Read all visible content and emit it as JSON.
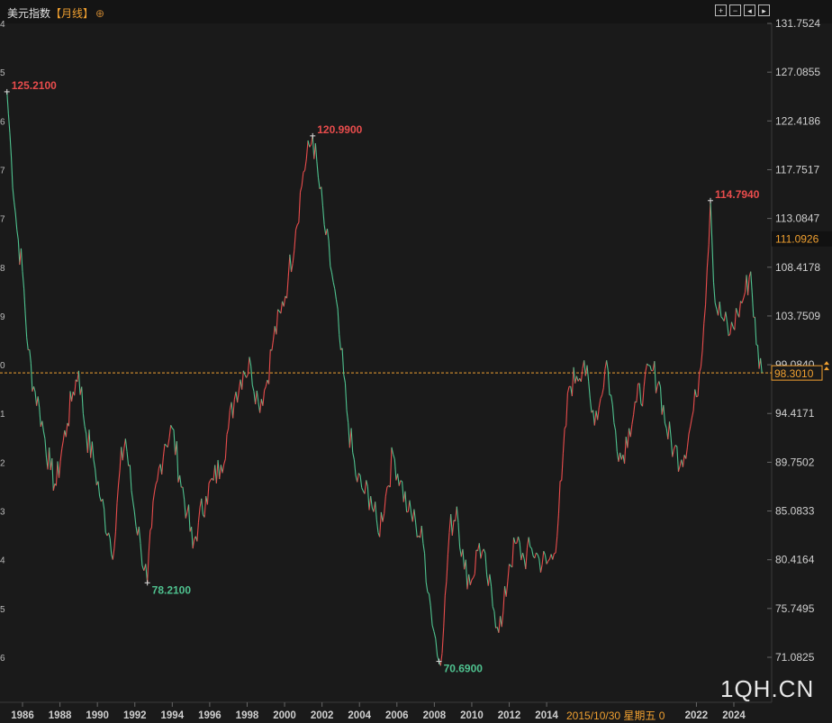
{
  "header": {
    "title": "美元指数",
    "period": "【月线】",
    "plus_icon": "⊕",
    "tools": [
      "plus-square-icon",
      "minus-square-icon",
      "chart-left-icon",
      "chart-right-icon"
    ]
  },
  "watermark": "1QH.CN",
  "cursor": {
    "date_label": "2015/10/30 星期五 0"
  },
  "colors": {
    "up": "#e84c4c",
    "down": "#4fc28f",
    "axis_label": "#cfcfcf",
    "ref_line": "#f0a030",
    "highlight_box": "#f0a030"
  },
  "chart_data": {
    "type": "line",
    "title": "",
    "xlabel": "",
    "ylabel": "",
    "ylim": [
      68.7,
      131.7524
    ],
    "y_ticks": [
      "131.7524",
      "127.0855",
      "122.4186",
      "117.7517",
      "113.0847",
      "108.4178",
      "103.7509",
      "99.0840",
      "94.4171",
      "89.7502",
      "85.0833",
      "80.4164",
      "75.7495",
      "71.0825"
    ],
    "x_ticks": [
      "1986",
      "1988",
      "1990",
      "1992",
      "1994",
      "1996",
      "1998",
      "2000",
      "2002",
      "2004",
      "2006",
      "2008",
      "2010",
      "2012",
      "2014",
      "2022",
      "2024"
    ],
    "left_partial_ticks": [
      "4",
      "5",
      "6",
      "7",
      "7",
      "8",
      "9",
      "0",
      "1",
      "2",
      "3",
      "4",
      "5",
      "6"
    ],
    "current_value": "111.0926",
    "last_value": "98.3010",
    "reference_line": 98.301,
    "annotations": [
      {
        "label": "125.2100",
        "date": 1985.17,
        "value": 125.21,
        "type": "high"
      },
      {
        "label": "78.2100",
        "date": 1992.67,
        "value": 78.21,
        "type": "low"
      },
      {
        "label": "120.9900",
        "date": 2001.5,
        "value": 120.99,
        "type": "high"
      },
      {
        "label": "70.6900",
        "date": 2008.25,
        "value": 70.69,
        "type": "low"
      },
      {
        "label": "114.7940",
        "date": 2022.75,
        "value": 114.794,
        "type": "high"
      }
    ],
    "series": [
      {
        "x": [
          1985.17,
          1985.4,
          1985.7,
          1986.0,
          1986.3,
          1986.6,
          1986.9,
          1987.2,
          1987.5,
          1987.8,
          1988.1,
          1988.4,
          1988.7,
          1989.0,
          1989.4,
          1989.8,
          1990.2,
          1990.6,
          1990.9,
          1991.2,
          1991.5,
          1991.9,
          1992.3,
          1992.67,
          1992.9,
          1993.2,
          1993.6,
          1994.0,
          1994.4,
          1994.8,
          1995.1,
          1995.4,
          1995.8,
          1996.2,
          1996.6,
          1997.0,
          1997.4,
          1997.8,
          1998.2,
          1998.6,
          1999.0,
          1999.4,
          1999.8,
          2000.2,
          2000.6,
          2001.0,
          2001.5,
          2001.8,
          2002.2,
          2002.6,
          2003.0,
          2003.4,
          2003.8,
          2004.2,
          2004.6,
          2005.0,
          2005.4,
          2005.8,
          2006.2,
          2006.6,
          2007.0,
          2007.4,
          2007.8,
          2008.25,
          2008.5,
          2008.8,
          2009.2,
          2009.6,
          2010.0,
          2010.4,
          2010.8,
          2011.2,
          2011.6,
          2012.0,
          2012.4,
          2012.8,
          2013.2,
          2013.6,
          2014.0,
          2014.4,
          2014.8,
          2015.2,
          2015.6,
          2016.0,
          2016.4,
          2016.8,
          2017.2,
          2017.6,
          2018.0,
          2018.4,
          2018.8,
          2019.2,
          2019.6,
          2020.0,
          2020.4,
          2020.8,
          2021.2,
          2021.6,
          2022.0,
          2022.4,
          2022.75,
          2023.0,
          2023.4,
          2023.8,
          2024.2,
          2024.6,
          2024.9,
          2025.2,
          2025.5
        ],
        "y": [
          125.21,
          119.0,
          112.0,
          108.0,
          100.5,
          97.0,
          95.0,
          92.0,
          89.0,
          87.5,
          91.0,
          93.5,
          96.5,
          98.5,
          92.5,
          90.0,
          86.0,
          83.0,
          81.5,
          89.0,
          92.0,
          86.0,
          82.0,
          78.21,
          83.5,
          88.0,
          91.5,
          93.0,
          88.5,
          85.0,
          81.5,
          84.0,
          86.5,
          88.0,
          89.5,
          93.0,
          96.5,
          98.5,
          99.0,
          95.5,
          97.0,
          101.5,
          104.0,
          107.5,
          112.0,
          117.5,
          120.99,
          117.0,
          111.5,
          107.0,
          100.5,
          93.5,
          88.5,
          87.0,
          86.5,
          83.0,
          86.5,
          90.5,
          88.0,
          85.0,
          84.0,
          82.0,
          76.0,
          70.69,
          74.0,
          83.0,
          85.5,
          79.5,
          78.5,
          82.0,
          79.0,
          75.5,
          74.0,
          80.0,
          82.0,
          80.5,
          81.5,
          80.5,
          80.0,
          81.0,
          88.0,
          97.0,
          98.0,
          99.5,
          94.5,
          95.0,
          99.5,
          93.5,
          90.0,
          93.0,
          95.5,
          97.0,
          98.5,
          97.5,
          93.0,
          91.0,
          90.0,
          92.5,
          96.0,
          103.0,
          114.794,
          105.0,
          103.5,
          102.0,
          104.0,
          106.0,
          108.0,
          101.0,
          98.3
        ]
      }
    ]
  }
}
